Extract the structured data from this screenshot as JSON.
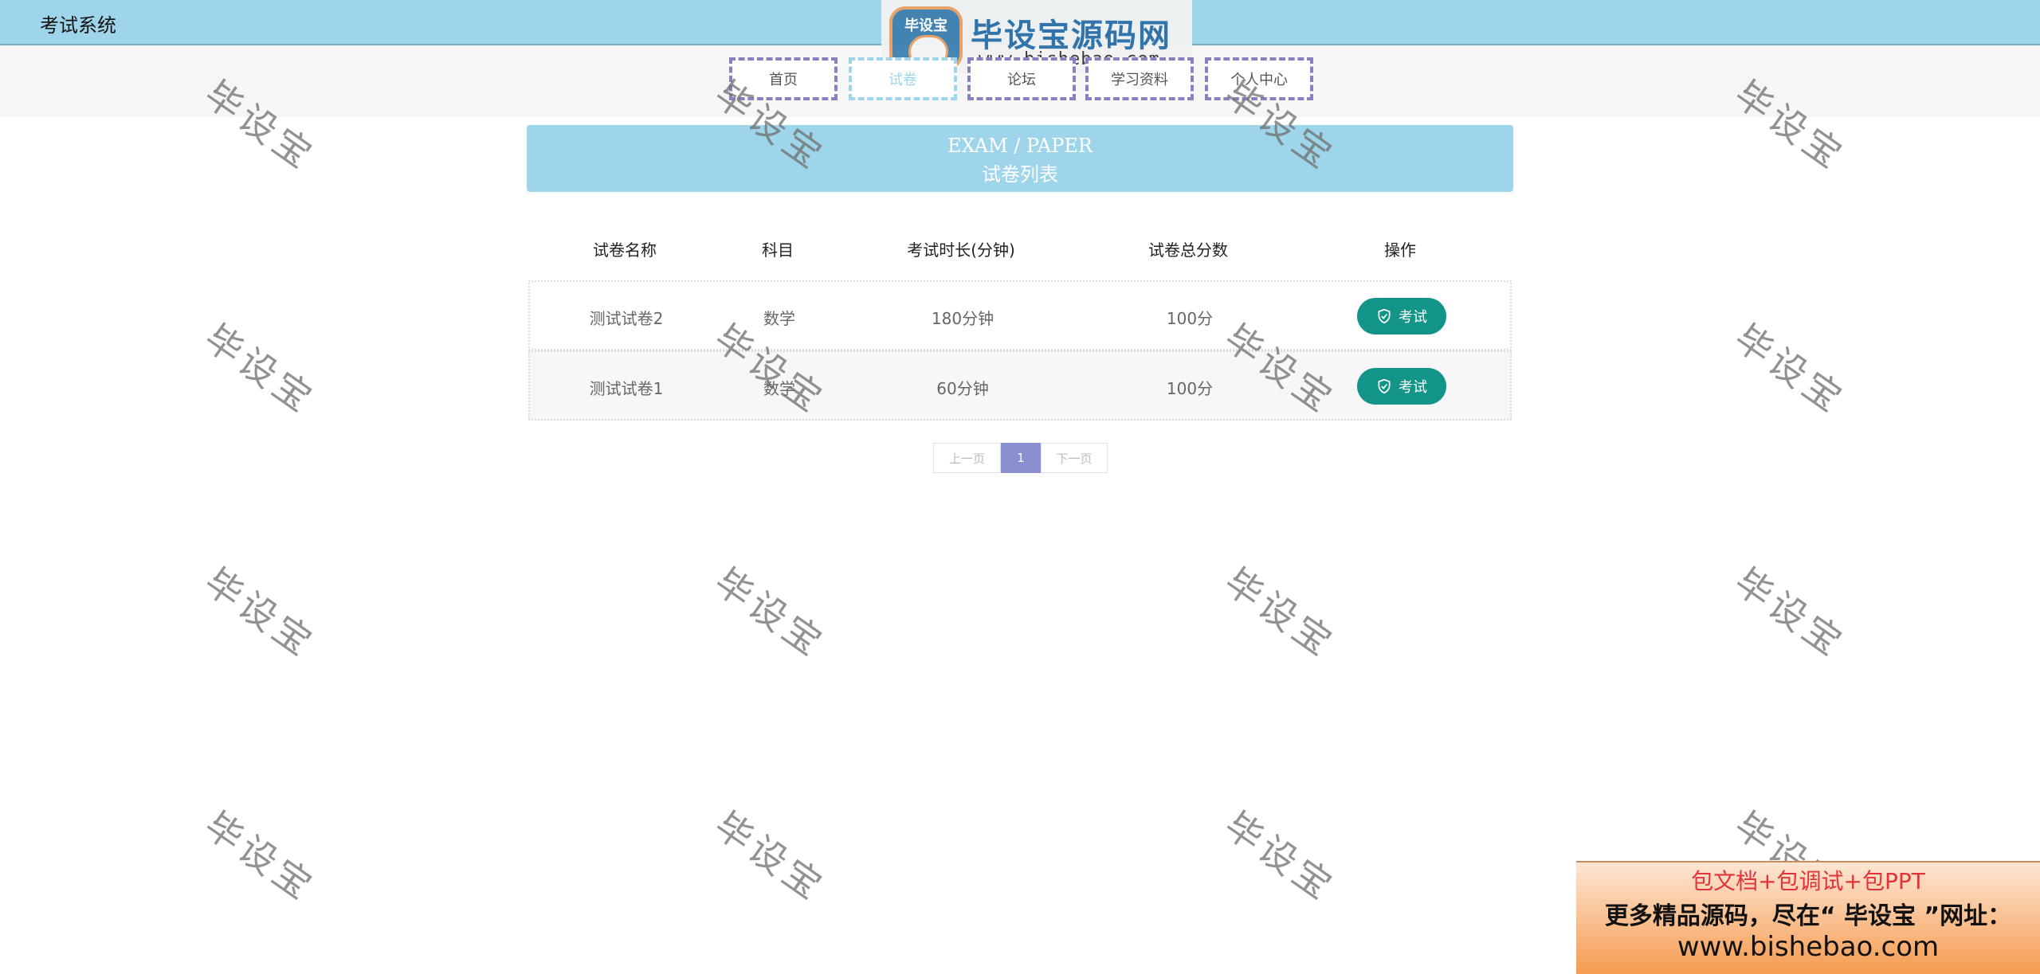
{
  "header": {
    "app_title": "考试系统"
  },
  "logo": {
    "badge": "毕设宝",
    "title": "毕设宝源码网",
    "url": "www.bishebao.com"
  },
  "nav": {
    "items": [
      {
        "label": "首页",
        "active": false
      },
      {
        "label": "试卷",
        "active": true
      },
      {
        "label": "论坛",
        "active": false
      },
      {
        "label": "学习资料",
        "active": false
      },
      {
        "label": "个人中心",
        "active": false
      }
    ]
  },
  "banner": {
    "en": "EXAM / PAPER",
    "zh": "试卷列表"
  },
  "table": {
    "headers": [
      "试卷名称",
      "科目",
      "考试时长(分钟)",
      "试卷总分数",
      "操作"
    ],
    "rows": [
      {
        "name": "测试试卷2",
        "subject": "数学",
        "duration": "180分钟",
        "score": "100分",
        "action": "考试"
      },
      {
        "name": "测试试卷1",
        "subject": "数学",
        "duration": "60分钟",
        "score": "100分",
        "action": "考试"
      }
    ]
  },
  "pagination": {
    "prev": "上一页",
    "current": "1",
    "next": "下一页"
  },
  "watermark": {
    "text": "毕设宝"
  },
  "ad": {
    "line1": "包文档+包调试+包PPT",
    "line2": "更多精品源码，尽在“ 毕设宝 ”网址：",
    "line3": "www.bishebao.com"
  },
  "colors": {
    "topbar": "#9fd5ea",
    "accent_nav": "#8a7fbf",
    "exam_button": "#139488",
    "page_active": "#8a8fd0"
  }
}
